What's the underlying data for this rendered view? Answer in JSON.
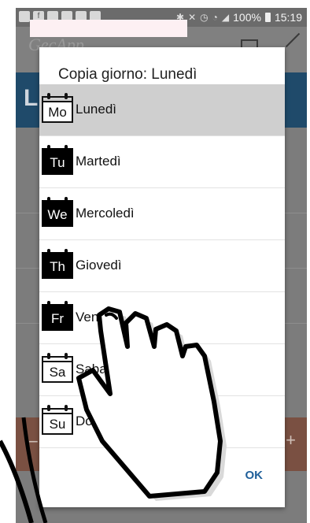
{
  "status_bar": {
    "battery": "100%",
    "time": "15:19"
  },
  "app": {
    "title": "GecApp",
    "bar_letter": "L",
    "minus": "−",
    "plus": "+"
  },
  "dialog": {
    "title": "Copia giorno: Lunedì",
    "items": [
      {
        "abbr": "Mo",
        "label": "Lunedì",
        "style": "outline",
        "selected": true
      },
      {
        "abbr": "Tu",
        "label": "Martedì",
        "style": "filled",
        "selected": false
      },
      {
        "abbr": "We",
        "label": "Mercoledì",
        "style": "filled",
        "selected": false
      },
      {
        "abbr": "Th",
        "label": "Giovedì",
        "style": "filled",
        "selected": false
      },
      {
        "abbr": "Fr",
        "label": "Venerdì",
        "style": "filled",
        "selected": false
      },
      {
        "abbr": "Sa",
        "label": "Sabato",
        "style": "outline",
        "selected": false
      },
      {
        "abbr": "Su",
        "label": "Domenica",
        "style": "outline",
        "selected": false
      }
    ],
    "ok_label": "OK"
  },
  "colors": {
    "accent": "#1f5f9a",
    "selected_row": "#cfcfcf",
    "app_bar": "#1f4a6a",
    "app_orange": "#7a5042"
  }
}
